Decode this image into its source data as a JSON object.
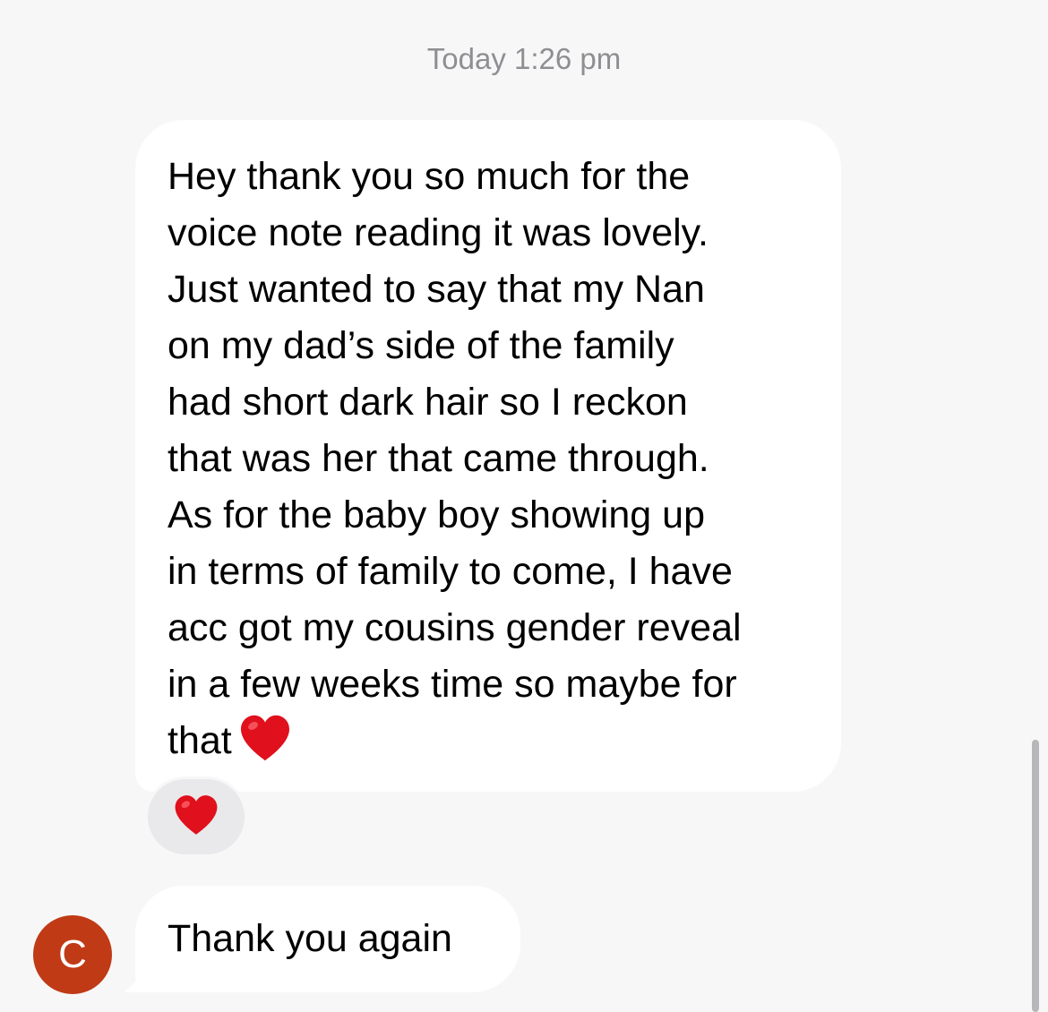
{
  "conversation": {
    "timestamp": "Today 1:26 pm",
    "messages": [
      {
        "lines": [
          "Hey thank you so much for the",
          "voice note reading it was lovely.",
          "Just wanted to say that my Nan",
          "on my dad’s side of the family",
          "had short dark hair so I reckon",
          "that was her that came through.",
          "As for the baby boy showing up",
          "in terms of family to come, I have",
          "acc got my cousins gender reveal",
          "in a few weeks time so maybe for",
          "that"
        ],
        "trailing_icon": "red-heart-icon",
        "reaction_icon": "red-heart-icon"
      },
      {
        "text": "Thank you again"
      }
    ],
    "sender": {
      "avatar_initial": "C",
      "avatar_color": "#c03a15"
    }
  },
  "colors": {
    "background": "#f7f7f7",
    "bubble": "#ffffff",
    "reaction_bg": "#e9e9eb",
    "heart": "#e0101c",
    "timestamp_text": "#8e8e93"
  }
}
